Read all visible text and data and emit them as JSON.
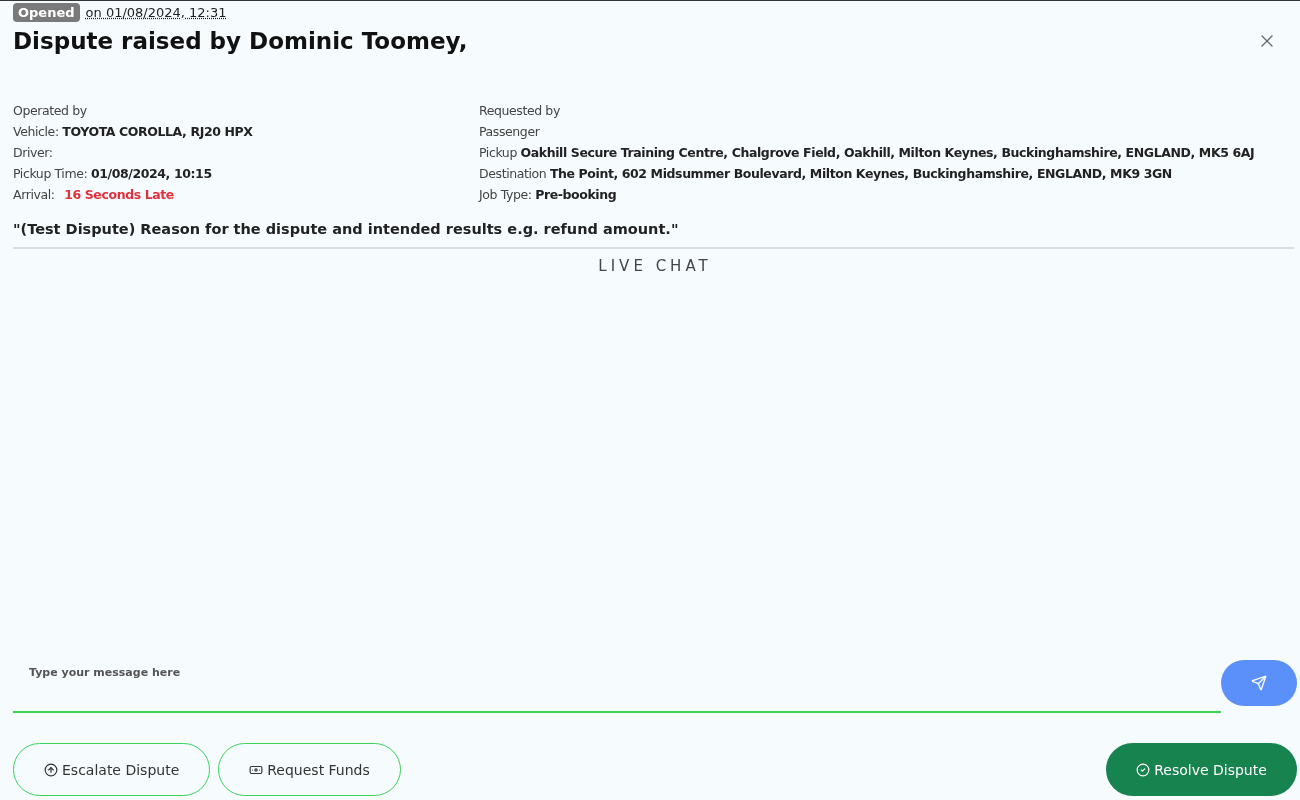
{
  "status": {
    "badge": "Opened",
    "date": "on 01/08/2024, 12:31"
  },
  "title": "Dispute raised by Dominic Toomey,",
  "left_details": [
    {
      "label": "Operated by"
    },
    {
      "label": "Vehicle: ",
      "value": "TOYOTA COROLLA, RJ20 HPX",
      "kind": "normal"
    },
    {
      "label": "Driver:"
    },
    {
      "label": "Pickup Time: ",
      "value": "01/08/2024, 10:15",
      "kind": "normal"
    },
    {
      "label": "Arrival: ",
      "value": "16 Seconds Late",
      "kind": "alert"
    }
  ],
  "right_details": [
    {
      "label": "Requested by"
    },
    {
      "label": "Passenger"
    },
    {
      "label": "Pickup ",
      "value": "Oakhill Secure Training Centre, Chalgrove Field, Oakhill, Milton Keynes, Buckinghamshire, ENGLAND, MK5 6AJ",
      "kind": "normal"
    },
    {
      "label": "Destination ",
      "value": "The Point, 602 Midsummer Boulevard, Milton Keynes, Buckinghamshire, ENGLAND, MK9 3GN",
      "kind": "normal"
    },
    {
      "label": "Job Type: ",
      "value": "Pre-booking",
      "kind": "normal"
    }
  ],
  "reason": "\"(Test Dispute) Reason for the dispute and intended results e.g. refund amount.\"",
  "chat": {
    "heading": "LIVE CHAT",
    "input_label": "Type your message here"
  },
  "actions": [
    {
      "label": "Escalate Dispute",
      "kind": "escalate"
    },
    {
      "label": "Request Funds",
      "kind": "funds"
    },
    {
      "label": "Resolve Dispute",
      "kind": "resolve"
    }
  ]
}
